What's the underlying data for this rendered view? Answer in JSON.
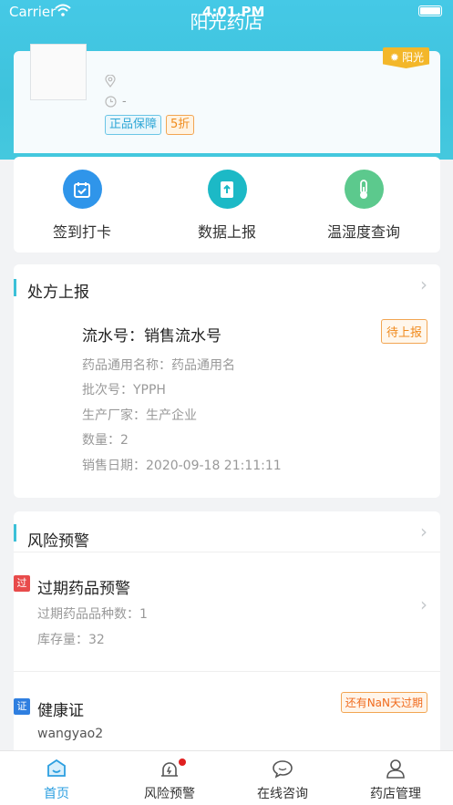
{
  "status_bar": {
    "carrier": "Carrier",
    "time": "4:01 PM"
  },
  "nav": {
    "title": "阳光药店"
  },
  "store": {
    "badge": "阳光",
    "location": "",
    "hours": "-",
    "tags": [
      "正品保障",
      "5折"
    ]
  },
  "quick_actions": [
    {
      "label": "签到打卡",
      "icon": "calendar-check-icon",
      "color": "#2f95ea"
    },
    {
      "label": "数据上报",
      "icon": "upload-doc-icon",
      "color": "#1cb9c6"
    },
    {
      "label": "温湿度查询",
      "icon": "thermometer-icon",
      "color": "#5cc98d"
    }
  ],
  "prescription": {
    "section_title": "处方上报",
    "serial": "流水号：销售流水号",
    "status": "待上报",
    "lines": [
      "药品通用名称：药品通用名",
      "批次号：YPPH",
      "生产厂家：生产企业",
      "数量：2",
      "销售日期：2020-09-18 21:11:11"
    ]
  },
  "risk": {
    "section_title": "风险预警",
    "expired": {
      "badge": "过",
      "title": "过期药品预警",
      "lines": [
        "过期药品品种数：1",
        "库存量：32"
      ]
    },
    "health": {
      "badge": "证",
      "title": "健康证",
      "expire_text": "还有NaN天过期",
      "lines": [
        "wangyao2"
      ]
    }
  },
  "tabbar": [
    {
      "label": "首页",
      "active": true
    },
    {
      "label": "风险预警",
      "active": false
    },
    {
      "label": "在线咨询",
      "active": false
    },
    {
      "label": "药店管理",
      "active": false
    }
  ],
  "colors": {
    "accent": "#3cc0d8",
    "tab_active": "#2c9fe0",
    "warn": "#f08a1c",
    "danger": "#e84b4b"
  }
}
